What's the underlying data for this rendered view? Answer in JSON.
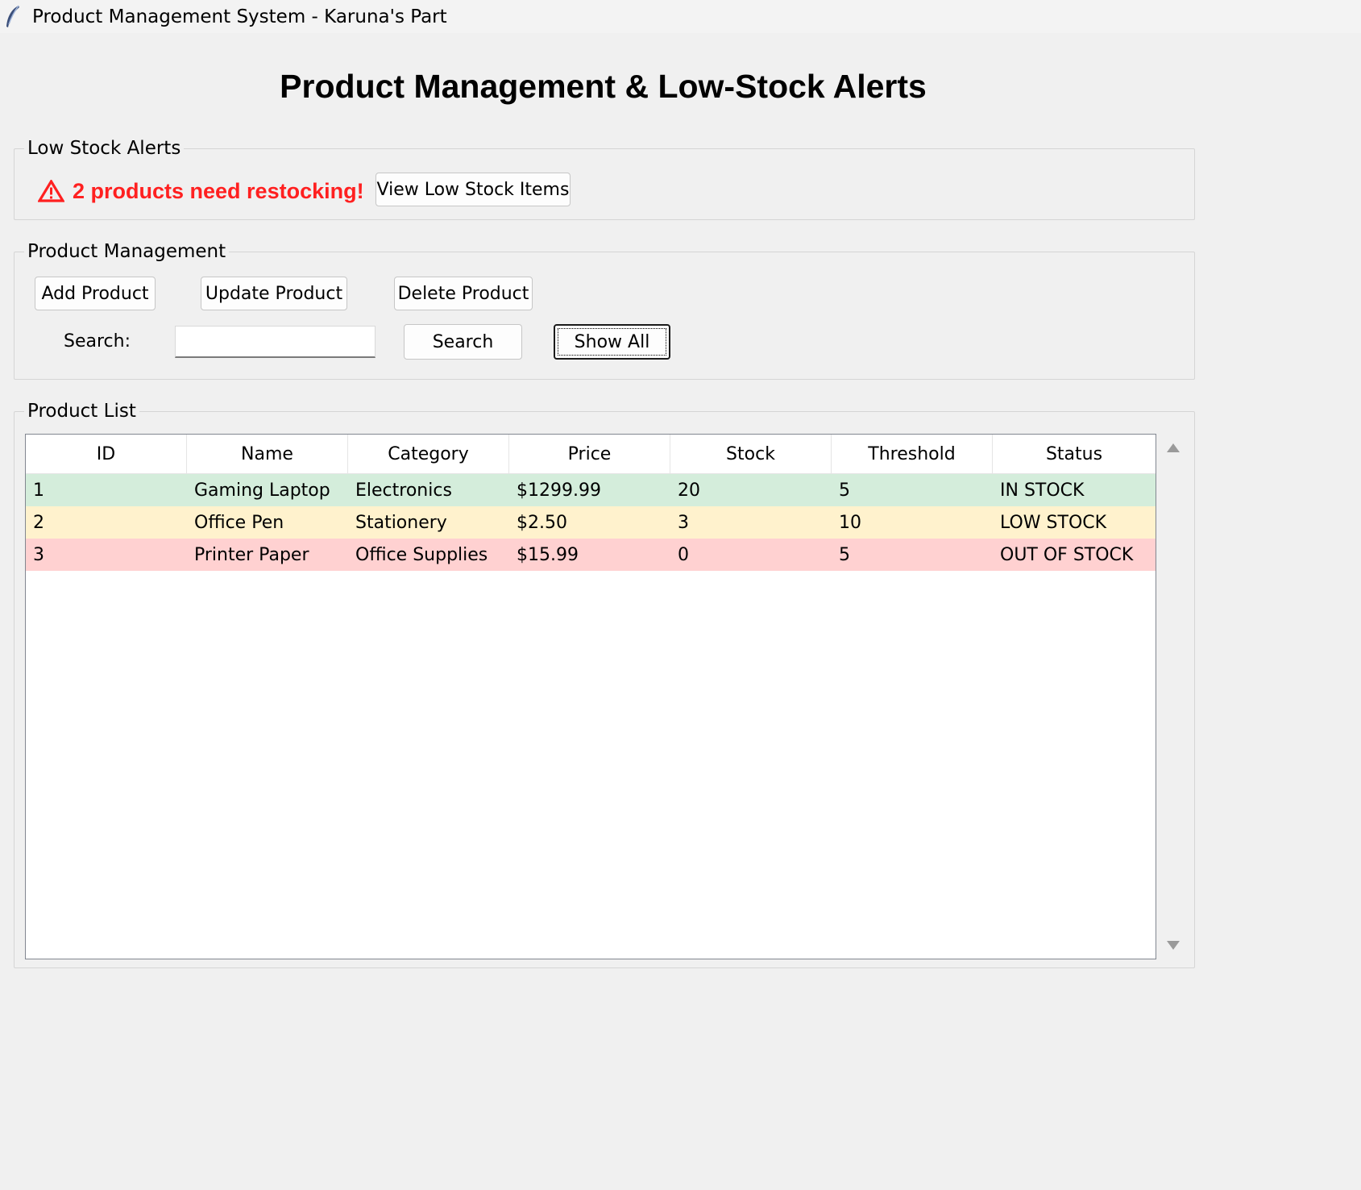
{
  "window": {
    "title": "Product Management System - Karuna's Part",
    "icon": "feather-icon"
  },
  "heading": "Product Management & Low-Stock Alerts",
  "low_stock_alerts": {
    "legend": "Low Stock Alerts",
    "warning_icon": "warning-triangle-icon",
    "message": "2 products need restocking!",
    "view_button": "View Low Stock Items",
    "alert_color": "#ff2020"
  },
  "product_management": {
    "legend": "Product Management",
    "add_button": "Add Product",
    "update_button": "Update Product",
    "delete_button": "Delete Product",
    "search_label": "Search:",
    "search_value": "",
    "search_button": "Search",
    "show_all_button": "Show All"
  },
  "product_list": {
    "legend": "Product List",
    "columns": [
      "ID",
      "Name",
      "Category",
      "Price",
      "Stock",
      "Threshold",
      "Status"
    ],
    "rows": [
      {
        "id": "1",
        "name": "Gaming Laptop",
        "category": "Electronics",
        "price": "$1299.99",
        "stock": "20",
        "threshold": "5",
        "status": "IN STOCK",
        "color": "#d4eddb"
      },
      {
        "id": "2",
        "name": "Office Pen",
        "category": "Stationery",
        "price": "$2.50",
        "stock": "3",
        "threshold": "10",
        "status": "LOW STOCK",
        "color": "#fff2cd"
      },
      {
        "id": "3",
        "name": "Printer Paper",
        "category": "Office Supplies",
        "price": "$15.99",
        "stock": "0",
        "threshold": "5",
        "status": "OUT OF STOCK",
        "color": "#ffd1d1"
      }
    ]
  }
}
